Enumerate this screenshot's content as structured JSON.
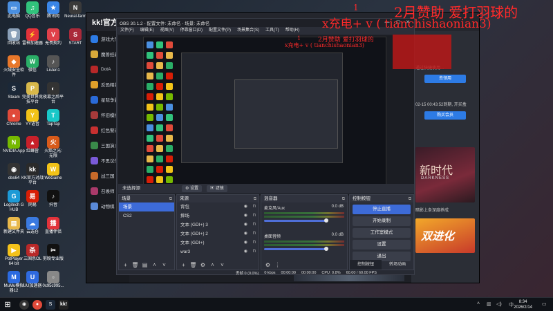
{
  "desktop": {
    "icons": [
      {
        "label": "此电脑",
        "color": "#4a8fe0",
        "glyph": "▭"
      },
      {
        "label": "回收站",
        "color": "#8aa0b8",
        "glyph": "🗑"
      },
      {
        "label": "火绒安全软件",
        "color": "#e8772a",
        "glyph": "◆"
      },
      {
        "label": "Steam",
        "color": "#1b2838",
        "glyph": "S"
      },
      {
        "label": "Chrome",
        "color": "#e04a3a",
        "glyph": "●"
      },
      {
        "label": "NVIDIA App",
        "color": "#76b900",
        "glyph": "N"
      },
      {
        "label": "obs64",
        "color": "#333333",
        "glyph": "◉"
      },
      {
        "label": "Logitech G HUB",
        "color": "#1c9ad6",
        "glyph": "G"
      },
      {
        "label": "新建文件夹",
        "color": "#e8b84a",
        "glyph": "▤"
      },
      {
        "label": "PotPlayer 64 bit",
        "color": "#f3c21a",
        "glyph": "▶"
      },
      {
        "label": "MuMu模拟器12",
        "color": "#2b6ae0",
        "glyph": "M"
      },
      {
        "label": "QQ音乐",
        "color": "#31c27c",
        "glyph": "♫"
      },
      {
        "label": "雷神加速器",
        "color": "#e2323a",
        "glyph": "⚡"
      },
      {
        "label": "微信",
        "color": "#2aae67",
        "glyph": "W"
      },
      {
        "label": "完美世界竞技平台",
        "color": "#d8b84a",
        "glyph": "P"
      },
      {
        "label": "YY语音",
        "color": "#f2c318",
        "glyph": "Y"
      },
      {
        "label": "红蜂营",
        "color": "#c8202a",
        "glyph": "▲"
      },
      {
        "label": "KK官方对战平台",
        "color": "#2a2a2a",
        "glyph": "kk"
      },
      {
        "label": "网易",
        "color": "#d81e06",
        "glyph": "易"
      },
      {
        "label": "云选仓",
        "color": "#3a7ae0",
        "glyph": "☁"
      },
      {
        "label": "三国杀OL",
        "color": "#b82828",
        "glyph": "杀"
      },
      {
        "label": "UU加速器",
        "color": "#2f6ae0",
        "glyph": "U"
      },
      {
        "label": "腾讯网",
        "color": "#3a86e8",
        "glyph": "★"
      },
      {
        "label": "无畏契约",
        "color": "#e0404a",
        "glyph": "V"
      },
      {
        "label": "Listen1",
        "color": "#555555",
        "glyph": "♪"
      },
      {
        "label": "夜幕之后平台",
        "color": "#333333",
        "glyph": "◐"
      },
      {
        "label": "TapTap",
        "color": "#19c8c8",
        "glyph": "T"
      },
      {
        "label": "火焰之光: 无限",
        "color": "#d85a1a",
        "glyph": "火"
      },
      {
        "label": "WeGame",
        "color": "#f2c318",
        "glyph": "W"
      },
      {
        "label": "抖音",
        "color": "#111111",
        "glyph": "♪"
      },
      {
        "label": "直播伴侣",
        "color": "#e2323a",
        "glyph": "播"
      },
      {
        "label": "剪映专业版",
        "color": "#111111",
        "glyph": "✂"
      },
      {
        "label": "0c95c995...",
        "color": "#888888",
        "glyph": "▫"
      },
      {
        "label": "Neural-farm",
        "color": "#3a3a3a",
        "glyph": "N"
      },
      {
        "label": "START",
        "color": "#aa2a3a",
        "glyph": "S"
      }
    ]
  },
  "kk": {
    "logo": "kk!官方",
    "sidebar": [
      {
        "label": "游戏大厅",
        "color": "#2d7be5"
      },
      {
        "label": "魔兽经典",
        "color": "#d8a83a"
      },
      {
        "label": "DotA",
        "color": "#b82828"
      },
      {
        "label": "反恐精英",
        "color": "#e0a02a"
      },
      {
        "label": "星际争霸",
        "color": "#2a6ad8"
      },
      {
        "label": "怀旧模拟",
        "color": "#a83a3a"
      },
      {
        "label": "红色警戒",
        "color": "#c83030"
      },
      {
        "label": "三国演义",
        "color": "#3a8a4a"
      },
      {
        "label": "不思议传说",
        "color": "#7a5ad8"
      },
      {
        "label": "战三国",
        "color": "#c86a2a"
      },
      {
        "label": "召唤师",
        "color": "#aa3a6a"
      },
      {
        "label": "动物棋",
        "color": "#5a8ad8"
      }
    ],
    "right_text1": "通过快捷使用...",
    "right_button1": "去领用",
    "right_text2": "02-15 00:43:52到期, 开买盒",
    "right_button2": "购买会员",
    "right_text3": "暗影上条深度养成",
    "banner_title": "新时代",
    "banner_sub": "DARKNESS",
    "banner2_title": "双进化"
  },
  "obs": {
    "title": "OBS 30.1.2 - 配置文件: 未命名 - 场景: 未命名",
    "menu": [
      "文件(F)",
      "编辑(E)",
      "视图(V)",
      "停靠窗口(D)",
      "配置文件(P)",
      "场景集合(S)",
      "工具(T)",
      "帮助(H)"
    ],
    "scene_bar_label": "未选择源",
    "scene_bar_tab1": "⚙ 设置",
    "scene_bar_tab2": "▣ 滤镜",
    "scenes_dock": {
      "title": "场景",
      "items": [
        "场景",
        "CS2"
      ]
    },
    "sources_dock": {
      "title": "来源",
      "items": [
        "背包",
        "摔场",
        "文本 (GDI+) 3",
        "文本 (GDI+) 2",
        "文本 (GDI+)",
        "war3"
      ]
    },
    "mixer_dock": {
      "title": "混音器",
      "tracks": [
        {
          "name": "麦克风/Aux",
          "db": "0.0 dB",
          "level": 0.78
        },
        {
          "name": "桌面音频",
          "db": "0.0 dB",
          "level": 0.78
        }
      ]
    },
    "controls_dock": {
      "title": "控制按钮",
      "buttons": [
        "停止直播",
        "开始录制",
        "工作室模式",
        "设置",
        "退出"
      ],
      "tabs": [
        "控制按钮",
        "转场动画"
      ]
    },
    "status": {
      "dropped": "丢帧 0 (0.0%)",
      "bitrate": "0 kbps",
      "live_time": "00:00:00",
      "rec_time": "00:00:00",
      "cpu": "CPU: 0.8%",
      "fps": "60.00 / 60.00 FPS"
    }
  },
  "overlay": {
    "text_big": "x充电+ v ( tianchishaonian3)",
    "text_top": "2月赞助   爱打羽球的",
    "num1": "1",
    "num2": "1",
    "small_text1": "x充电+ v ( tianchishaonian3)",
    "small_text2": "2月赞助  爱打羽球的"
  },
  "taskbar": {
    "time": "8:34",
    "date": "2026/2/14",
    "lang": "中",
    "kk_label": "kk!"
  },
  "colors": {
    "accent": "#3d6bd8",
    "overlay_red": "#ff2a2a"
  }
}
